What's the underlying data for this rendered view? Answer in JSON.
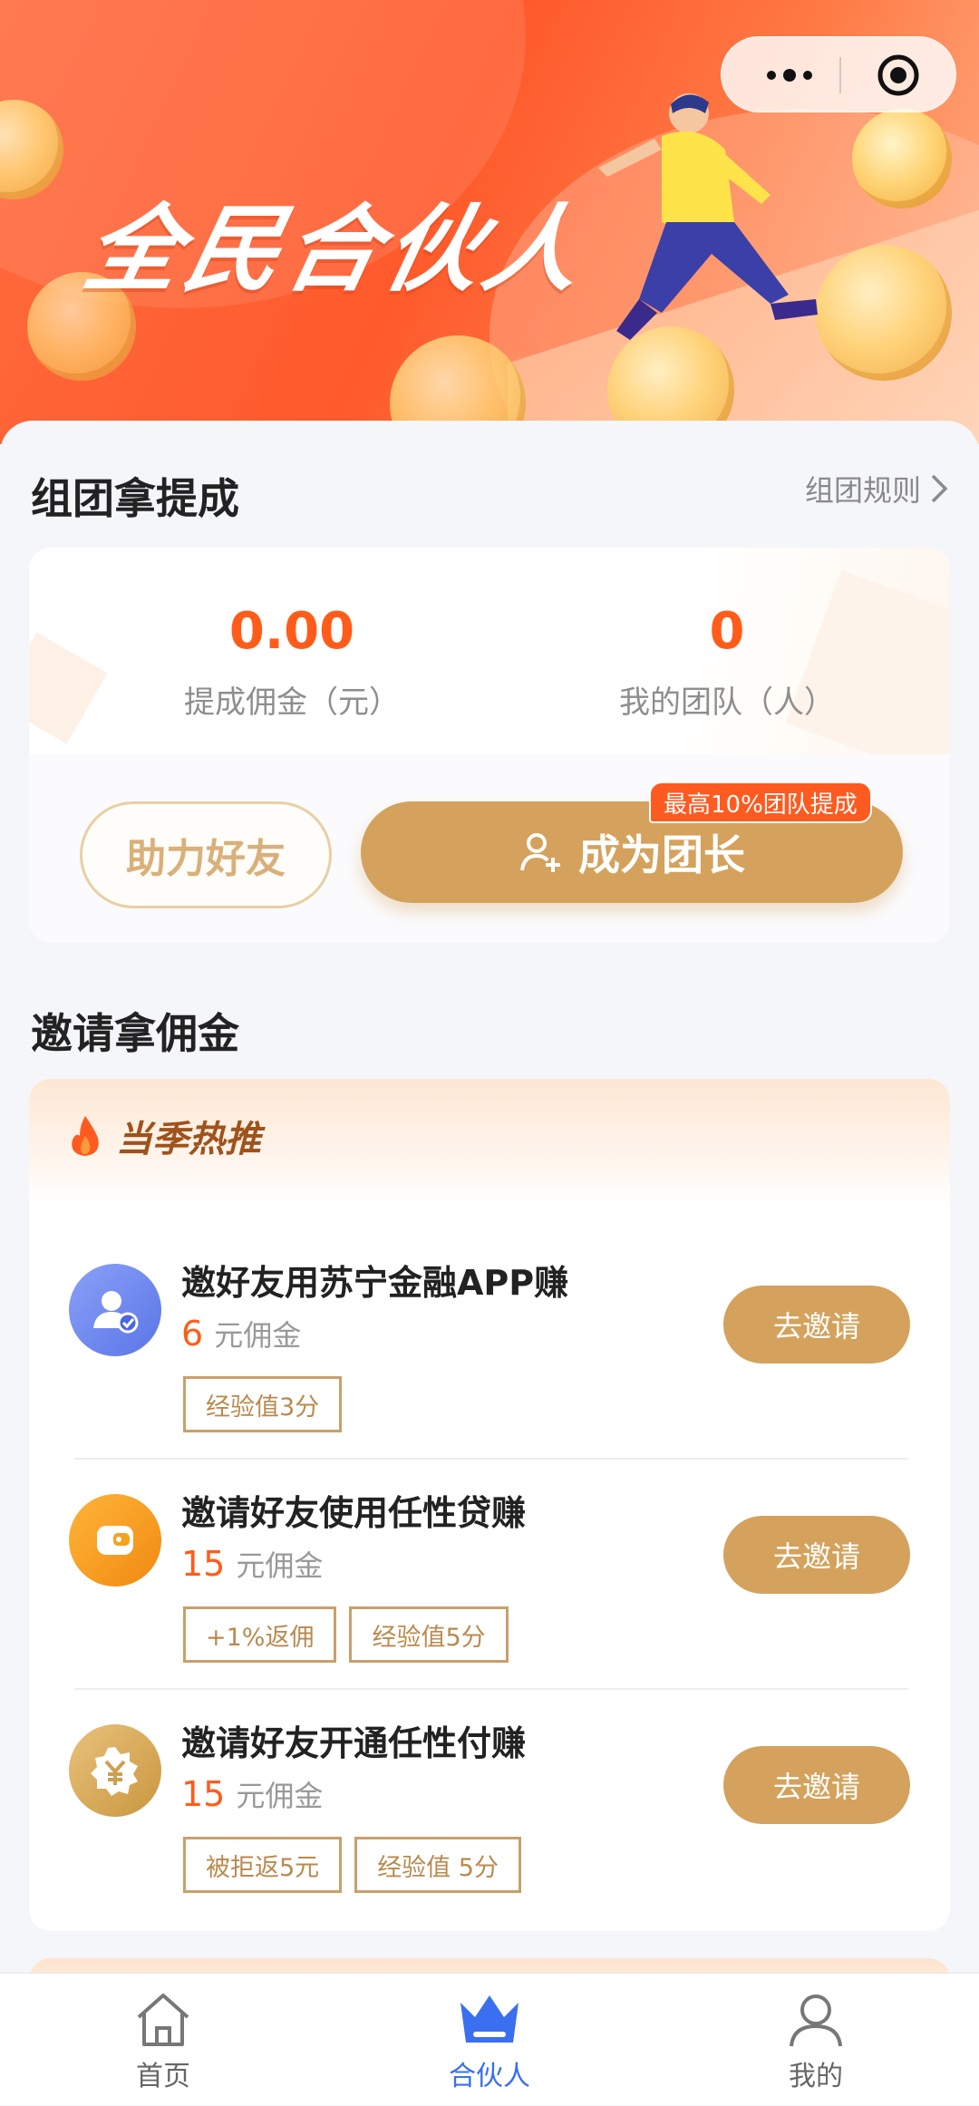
{
  "banner": {
    "title": "全民合伙人",
    "capsule": {
      "more_icon": "more-dots-icon",
      "close_icon": "target-icon"
    }
  },
  "team": {
    "section_title": "组团拿提成",
    "rules_link": "组团规则",
    "stats": [
      {
        "value": "0.00",
        "label": "提成佣金（元）"
      },
      {
        "value": "0",
        "label": "我的团队（人）"
      }
    ],
    "help_button": "助力好友",
    "leader_button": "成为团长",
    "leader_badge": "最高10%团队提成"
  },
  "invite": {
    "section_title": "邀请拿佣金",
    "hot_title": "当季热推",
    "items": [
      {
        "name": "邀好友用苏宁金融APP赚",
        "amount": "6",
        "unit": "元佣金",
        "tags": [
          "经验值3分"
        ],
        "button": "去邀请",
        "icon": "user-verified-icon",
        "icon_color": "#6b86f2"
      },
      {
        "name": "邀请好友使用任性贷赚",
        "amount": "15",
        "unit": "元佣金",
        "tags": [
          "+1%返佣",
          "经验值5分"
        ],
        "button": "去邀请",
        "icon": "wallet-icon",
        "icon_color": "#f7a021"
      },
      {
        "name": "邀请好友开通任性付赚",
        "amount": "15",
        "unit": "元佣金",
        "tags": [
          "被拒返5元",
          "经验值 5分"
        ],
        "button": "去邀请",
        "icon": "yuan-icon",
        "icon_color": "#d9ad63"
      }
    ]
  },
  "tabbar": {
    "items": [
      {
        "label": "首页",
        "icon": "home-icon",
        "active": false
      },
      {
        "label": "合伙人",
        "icon": "crown-icon",
        "active": true
      },
      {
        "label": "我的",
        "icon": "user-icon",
        "active": false
      }
    ]
  },
  "colors": {
    "accent_orange": "#ff5c1a",
    "gold": "#d4a25c",
    "tab_active": "#3a6ff0"
  }
}
